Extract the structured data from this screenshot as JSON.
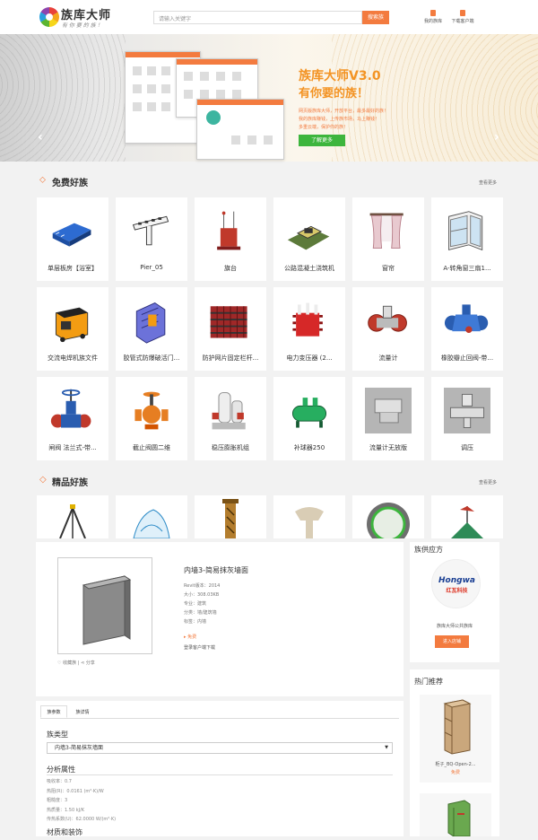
{
  "header": {
    "brand_name": "族库大师",
    "brand_slogan": "有 你 要 的 族 ！",
    "search_placeholder": "请输入关键字",
    "search_button": "搜索族",
    "my_library": "我的族库",
    "download_client": "下载客户端"
  },
  "banner": {
    "title": "族库大师V3.0",
    "subtitle": "有你要的族！",
    "lines": [
      "网页版族库大师，开放平台，最多最好的族！",
      "我的族库赚钱，上传族市场，马上赚钱！",
      "多重云端，保护你的族！"
    ],
    "cta": "了解更多",
    "prev": "‹",
    "next": "›",
    "colors": {
      "accent": "#f39323",
      "cta": "#3db53d"
    }
  },
  "free": {
    "title": "免费好族",
    "more": "查看更多",
    "items": [
      {
        "label": "单层板房【浴室】",
        "icon": "prefab-house-icon"
      },
      {
        "label": "Pier_05",
        "icon": "pier-icon"
      },
      {
        "label": "旗台",
        "icon": "flag-platform-icon"
      },
      {
        "label": "公路混凝土浇筑机",
        "icon": "concrete-paver-icon"
      },
      {
        "label": "窗帘",
        "icon": "curtain-icon"
      },
      {
        "label": "A-转角窗三扇1...",
        "icon": "corner-window-icon"
      },
      {
        "label": "交流电焊机族文件",
        "icon": "welder-icon"
      },
      {
        "label": "胶管式防爆破活门...",
        "icon": "blast-valve-icon"
      },
      {
        "label": "防护网片固定栏杆...",
        "icon": "guard-rail-icon"
      },
      {
        "label": "电力变压器 (2...",
        "icon": "transformer-icon"
      },
      {
        "label": "流量计",
        "icon": "flowmeter-icon"
      },
      {
        "label": "橡胶瓣止回阀-带...",
        "icon": "check-valve-icon"
      },
      {
        "label": "闸阀 法兰式-带...",
        "icon": "gate-valve-icon"
      },
      {
        "label": "截止阀圆二维",
        "icon": "globe-valve-icon"
      },
      {
        "label": "稳压膨胀机组",
        "icon": "expansion-unit-icon"
      },
      {
        "label": "补球器250",
        "icon": "tank-icon"
      },
      {
        "label": "流量计无放版",
        "icon": "flowmeter-box-icon"
      },
      {
        "label": "调压",
        "icon": "regulator-icon"
      }
    ]
  },
  "premium": {
    "title": "精品好族",
    "more": "查看更多"
  },
  "detail": {
    "name": "内墙3-简易抹灰墙面",
    "meta": [
      "Revit版本：2014",
      "大小：308.03KB",
      "专业：建筑",
      "分类：墙/建筑墙",
      "标签：内墙"
    ],
    "free_badge": "免费",
    "client_download": "登录客户端下载",
    "favorite": "收藏族 | ",
    "share": "分享"
  },
  "tabs": {
    "items": [
      "族参数",
      "族详情"
    ],
    "family_type_label": "族类型",
    "family_type_value": "内墙3-简易抹灰墙面",
    "analysis_title": "分析属性",
    "props": [
      "吸收率：0.7",
      "热阻(R)：0.0161 (m²·K)/W",
      "粗糙度：3",
      "热质量：1.50 kJ/K",
      "传热系数(U)：62.0000 W/(m²·K)"
    ],
    "material_title": "材质和装饰"
  },
  "sidebar": {
    "supplier_title": "族供应方",
    "supplier_logo_text": "Hongwa",
    "supplier_logo_cn": "红瓦科技",
    "supplier_desc": "族库大师公共族库",
    "enter_button": "进入店铺",
    "hot_title": "热门推荐",
    "hot_items": [
      {
        "name": "柜子_BQ-Open-2...",
        "price": "免费"
      }
    ]
  }
}
